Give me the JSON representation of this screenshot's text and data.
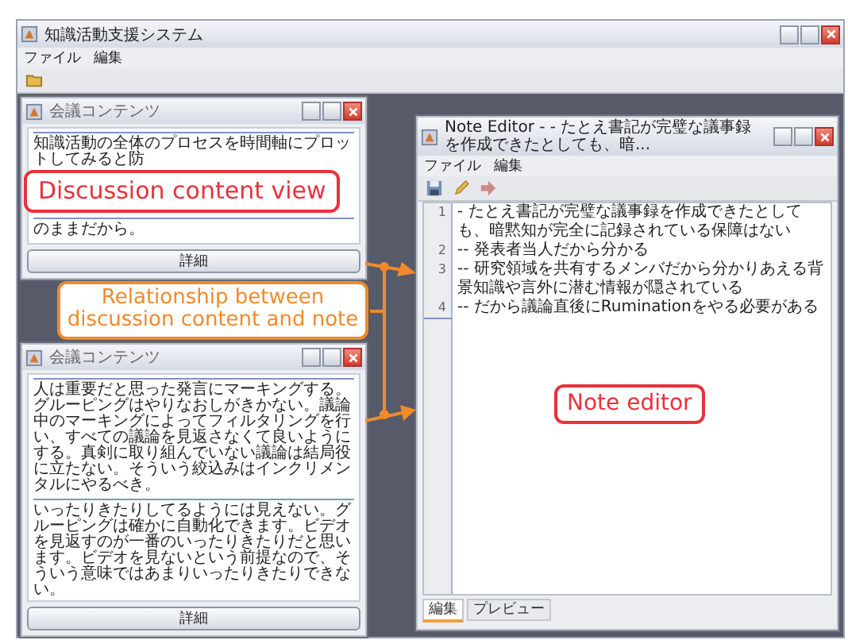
{
  "main_window": {
    "title": "知識活動支援システム",
    "menu": [
      "ファイル",
      "編集"
    ]
  },
  "content_windows": [
    {
      "title": "会議コンテンツ",
      "paragraphs": [
        "知識活動の全体のプロセスを時間軸にプロットしてみると防",
        "のままだから。"
      ],
      "button": "詳細"
    },
    {
      "title": "会議コンテンツ",
      "paragraphs": [
        "人は重要だと思った発言にマーキングする。グルーピングはやりなおしがきかない。議論中のマーキングによってフィルタリングを行い、すべての議論を見返さなくて良いようにする。真剣に取り組んでいない議論は結局役に立たない。そういう絞込みはインクリメンタルにやるべき。",
        "いったりきたりしてるようには見えない。グルーピングは確かに自動化できます。ビデオを見返すのが一番のいったりきたりだと思います。ビデオを見ないという前提なので、そういう意味ではあまりいったりきたりできない。"
      ],
      "button": "詳細"
    }
  ],
  "note_editor": {
    "title": "Note Editor - - たとえ書記が完璧な議事録を作成できたとしても、暗...",
    "menu": [
      "ファイル",
      "編集"
    ],
    "lines": [
      {
        "number": "1",
        "text": "- たとえ書記が完璧な議事録を作成できたとしても、暗黙知が完全に記録されている保障はない"
      },
      {
        "number": "2",
        "text": "-- 発表者当人だから分かる"
      },
      {
        "number": "3",
        "text": "-- 研究領域を共有するメンバだから分かりあえる背景知識や言外に潜む情報が隠されている"
      },
      {
        "number": "4",
        "text": "-- だから議論直後にRuminationをやる必要がある"
      }
    ],
    "tabs": [
      {
        "label": "編集",
        "selected": true
      },
      {
        "label": "プレビュー",
        "selected": false
      }
    ]
  },
  "callouts": [
    {
      "text": "Discussion content view",
      "color": "#e8323c"
    },
    {
      "text": "Relationship between discussion content and note",
      "color": "#f08a2c"
    },
    {
      "text": "Note editor",
      "color": "#e8323c"
    }
  ]
}
